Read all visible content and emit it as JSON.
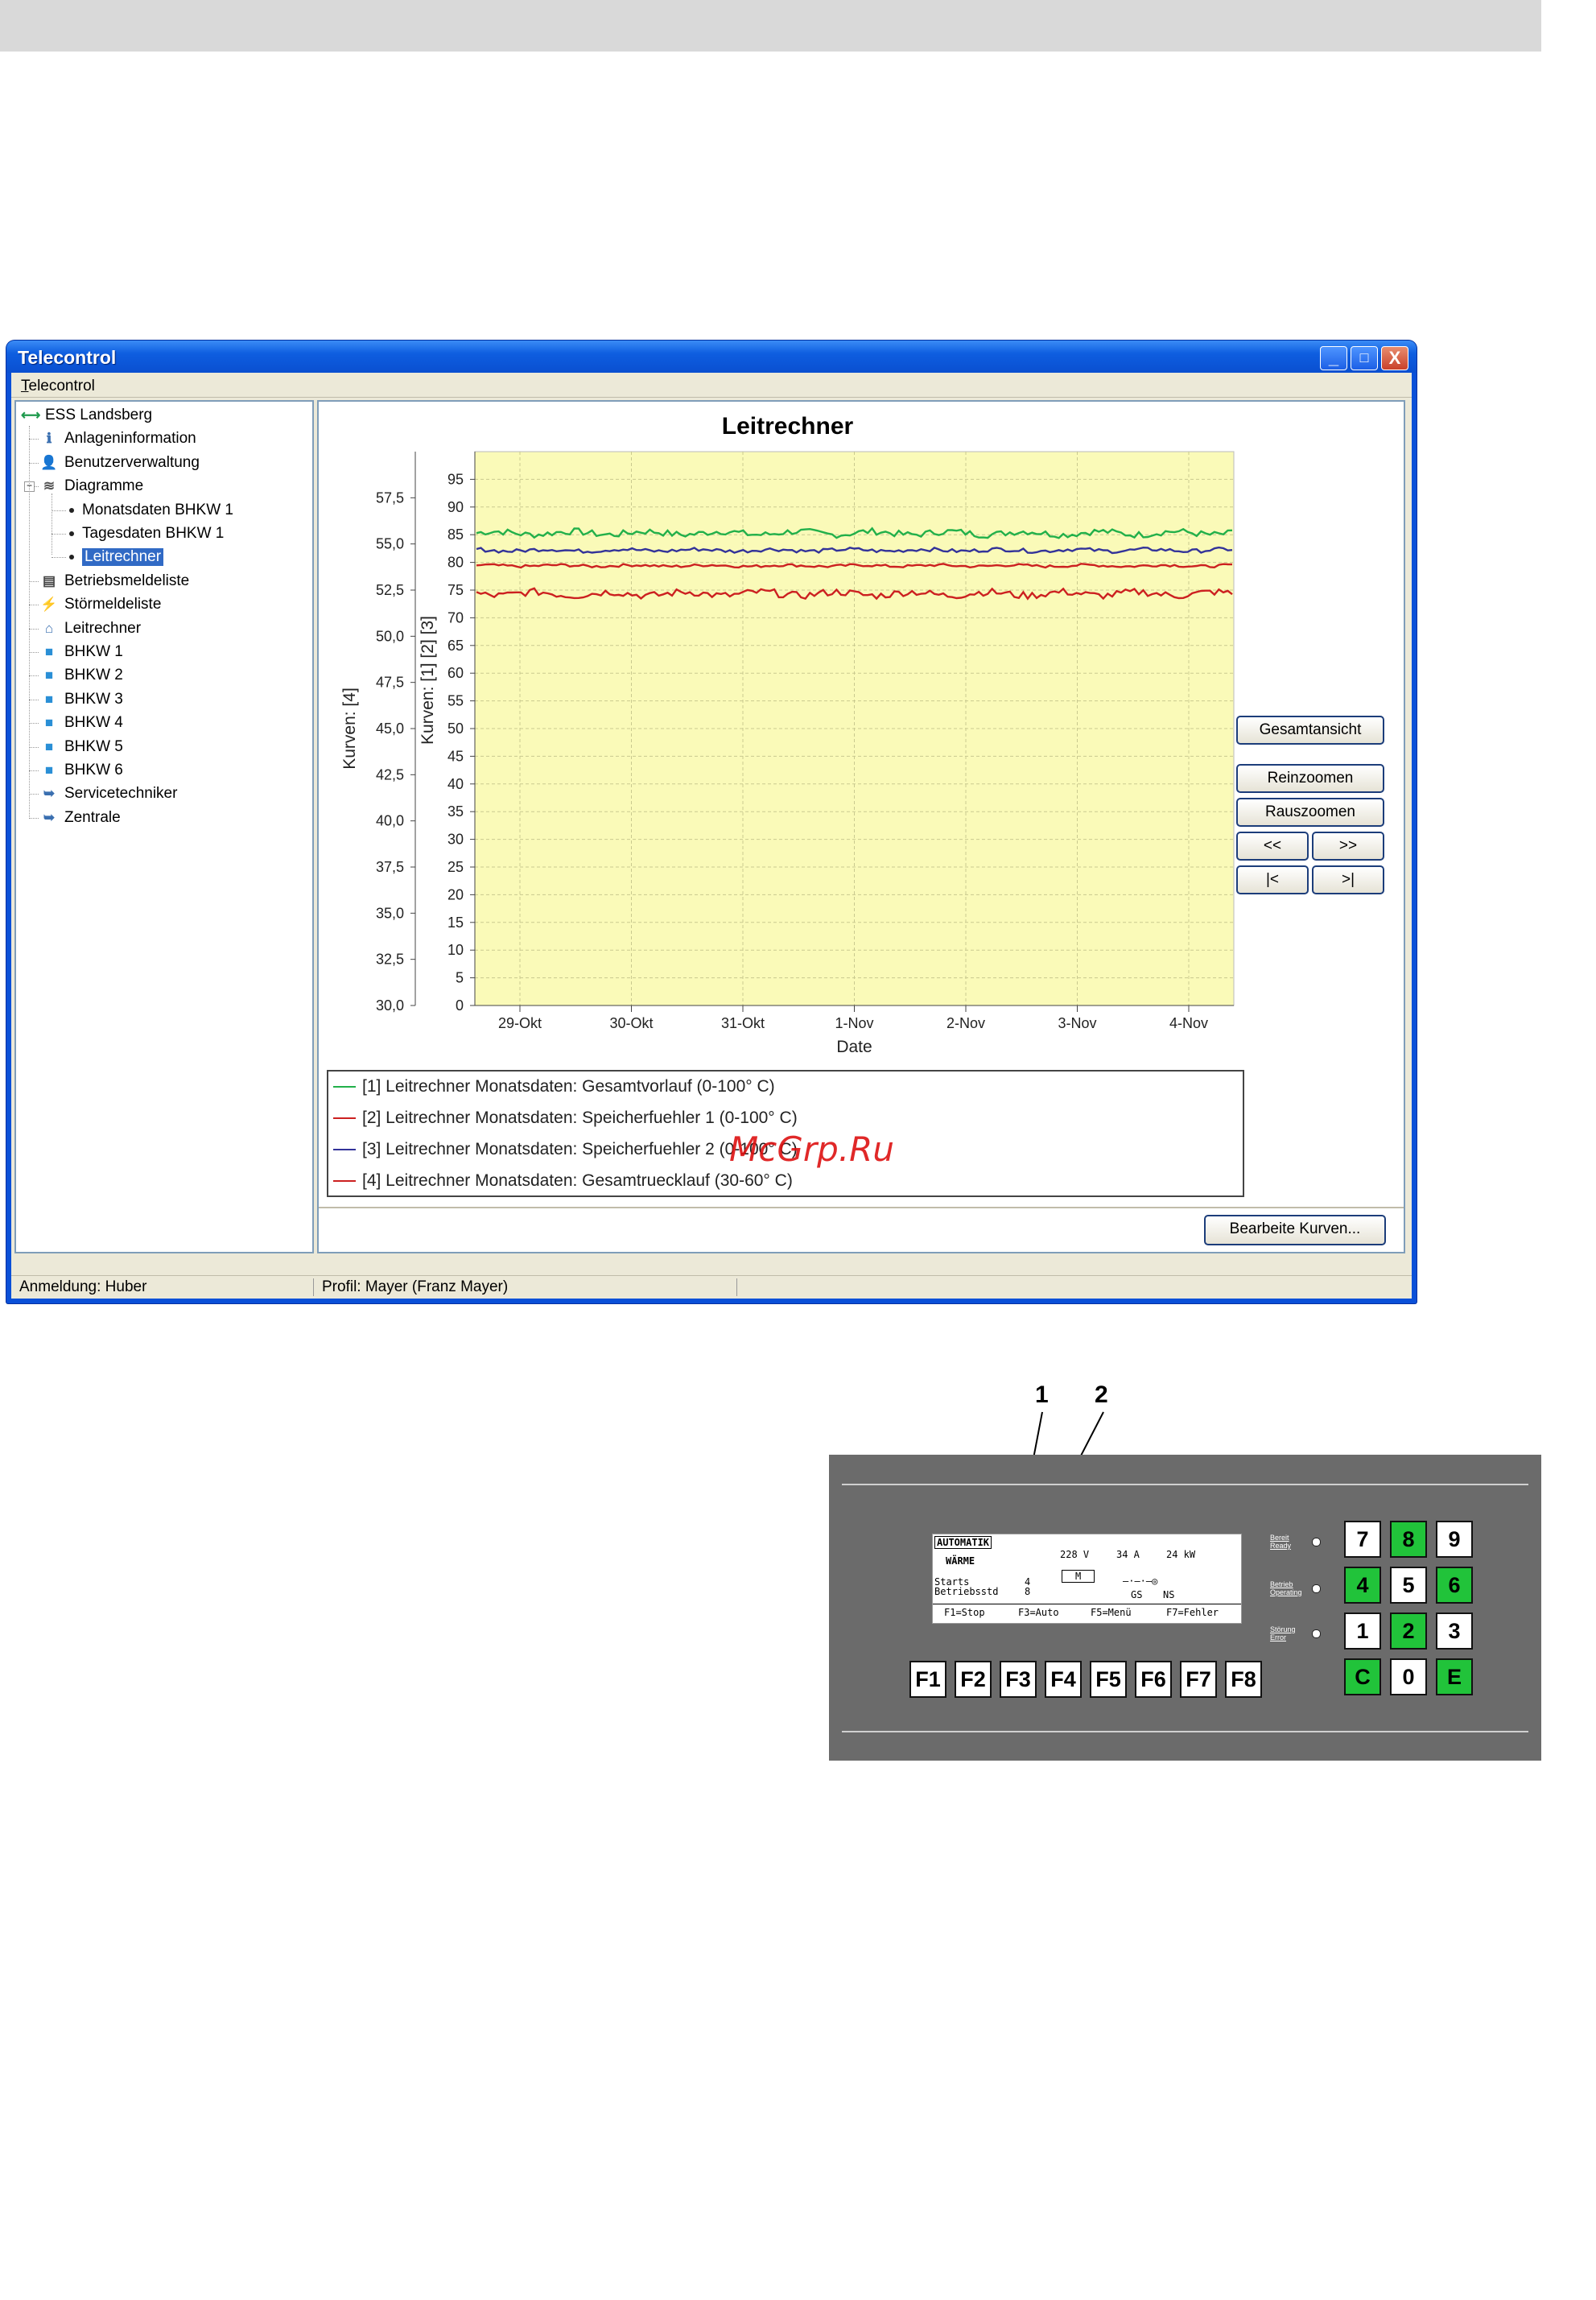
{
  "window": {
    "title": "Telecontrol",
    "menu": [
      "Telecontrol"
    ],
    "title_buttons": {
      "minimize": "_",
      "maximize": "□",
      "close": "X"
    }
  },
  "tree": {
    "items": [
      {
        "label": "ESS Landsberg",
        "icon": "connection-icon"
      },
      {
        "label": "Anlageninformation",
        "icon": "info-icon"
      },
      {
        "label": "Benutzerverwaltung",
        "icon": "user-icon"
      },
      {
        "label": "Diagramme",
        "icon": "chart-icon",
        "expander": "−"
      },
      {
        "label": "Monatsdaten BHKW 1",
        "icon": "bullet"
      },
      {
        "label": "Tagesdaten BHKW 1",
        "icon": "bullet"
      },
      {
        "label": "Leitrechner",
        "icon": "bullet",
        "selected": true
      },
      {
        "label": "Betriebsmeldeliste",
        "icon": "list-icon"
      },
      {
        "label": "Störmeldeliste",
        "icon": "lightning-icon"
      },
      {
        "label": "Leitrechner",
        "icon": "home-icon"
      },
      {
        "label": "BHKW 1",
        "icon": "cube-icon"
      },
      {
        "label": "BHKW 2",
        "icon": "cube-icon"
      },
      {
        "label": "BHKW 3",
        "icon": "cube-icon"
      },
      {
        "label": "BHKW 4",
        "icon": "cube-icon"
      },
      {
        "label": "BHKW 5",
        "icon": "cube-icon"
      },
      {
        "label": "BHKW 6",
        "icon": "cube-icon"
      },
      {
        "label": "Servicetechniker",
        "icon": "arrow-icon"
      },
      {
        "label": "Zentrale",
        "icon": "arrow-icon"
      }
    ]
  },
  "chart_data": {
    "type": "line",
    "title": "Leitrechner",
    "xlabel": "Date",
    "ylabel_right_axis": "Kurven: [1] [2] [3]",
    "ylabel_left_axis": "Kurven: [4]",
    "x": [
      "29-Okt",
      "30-Okt",
      "31-Okt",
      "1-Nov",
      "2-Nov",
      "3-Nov",
      "4-Nov"
    ],
    "yticks_inner": [
      "0",
      "5",
      "10",
      "15",
      "20",
      "25",
      "30",
      "35",
      "40",
      "45",
      "50",
      "55",
      "60",
      "65",
      "70",
      "75",
      "80",
      "85",
      "90",
      "95"
    ],
    "yticks_outer": [
      "30,0",
      "32,5",
      "35,0",
      "37,5",
      "40,0",
      "42,5",
      "45,0",
      "47,5",
      "50,0",
      "52,5",
      "55,0",
      "57,5"
    ],
    "ylim_inner": [
      0,
      100
    ],
    "ylim_outer": [
      30,
      60
    ],
    "grid": true,
    "background": "#fafab8",
    "series": [
      {
        "name": "[1] Leitrechner Monatsdaten: Gesamtvorlauf (0-100° C)",
        "color": "#22b04a",
        "axis": "inner",
        "level": 85.3,
        "noise": 0.6
      },
      {
        "name": "[2] Leitrechner Monatsdaten: Speicherfuehler 1 (0-100° C)",
        "color": "#cc2020",
        "axis": "inner",
        "level": 79.4,
        "noise": 0.25
      },
      {
        "name": "[3] Leitrechner Monatsdaten: Speicherfuehler 2 (0-100° C)",
        "color": "#333399",
        "axis": "inner",
        "level": 82.2,
        "noise": 0.35
      },
      {
        "name": "[4] Leitrechner Monatsdaten: Gesamtruecklauf (30-60° C)",
        "color": "#cc2020",
        "axis": "outer",
        "level": 52.3,
        "noise": 0.2
      }
    ]
  },
  "buttons": {
    "overview": "Gesamtansicht",
    "zoom_in": "Reinzoomen",
    "zoom_out": "Rauszoomen",
    "prev": "<<",
    "next": ">>",
    "first": "|<",
    "last": ">|",
    "edit_curves": "Bearbeite Kurven..."
  },
  "status": {
    "login": "Anmeldung: Huber",
    "profile": "Profil: Mayer (Franz Mayer)"
  },
  "watermark": "McGrp.Ru",
  "controller": {
    "callouts": [
      "1",
      "2"
    ],
    "lcd": {
      "mode": "AUTOMATIK",
      "sub": "WÄRME",
      "voltage": "228 V",
      "current": "34 A",
      "power": "24 kW",
      "motor": "M",
      "gs": "GS",
      "ns": "NS",
      "starts_label": "Starts",
      "starts_value": "4",
      "hours_label": "Betriebsstd",
      "hours_value": "8",
      "softkeys": [
        "F1=Stop",
        "F3=Auto",
        "F5=Menü",
        "F7=Fehler"
      ]
    },
    "leds": [
      {
        "label1": "Bereit",
        "label2": "Ready"
      },
      {
        "label1": "Betrieb",
        "label2": "Operating"
      },
      {
        "label1": "Störung",
        "label2": "Error"
      }
    ],
    "fkeys": [
      "F1",
      "F2",
      "F3",
      "F4",
      "F5",
      "F6",
      "F7",
      "F8"
    ],
    "keypad": [
      {
        "label": "7",
        "green": false
      },
      {
        "label": "8",
        "green": true
      },
      {
        "label": "9",
        "green": false
      },
      {
        "label": "4",
        "green": true
      },
      {
        "label": "5",
        "green": false
      },
      {
        "label": "6",
        "green": true
      },
      {
        "label": "1",
        "green": false
      },
      {
        "label": "2",
        "green": true
      },
      {
        "label": "3",
        "green": false
      },
      {
        "label": "C",
        "green": true
      },
      {
        "label": "0",
        "green": false
      },
      {
        "label": "E",
        "green": true
      }
    ]
  }
}
